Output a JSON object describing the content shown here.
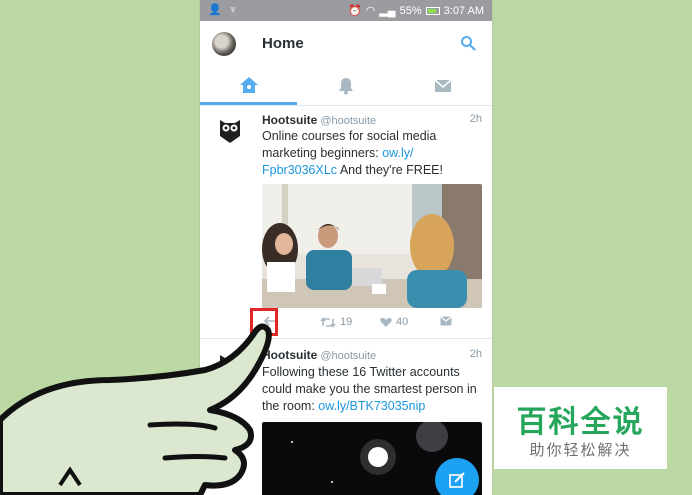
{
  "status_bar": {
    "battery": "55%",
    "time": "3:07 AM"
  },
  "header": {
    "title": "Home"
  },
  "tabs": [
    {
      "name": "home",
      "icon": "home-icon",
      "active": true
    },
    {
      "name": "notifications",
      "icon": "bell-icon",
      "active": false
    },
    {
      "name": "messages",
      "icon": "envelope-icon",
      "active": false
    }
  ],
  "tweets": [
    {
      "name": "Hootsuite",
      "handle": "@hootsuite",
      "time": "2h",
      "text_before": "Online courses for social media marketing beginners: ",
      "link": "ow.ly/ Fpbr3036XLc",
      "text_after": " And they're FREE!",
      "retweets": "19",
      "likes": "40"
    },
    {
      "name": "Hootsuite",
      "handle": "@hootsuite",
      "time": "2h",
      "text_before": "Following these 16 Twitter accounts could make you the smartest person in the room: ",
      "link": "ow.ly/BTK73035nip",
      "text_after": ""
    }
  ],
  "watermark": {
    "title": "百科全说",
    "subtitle": "助你轻松解决"
  },
  "colors": {
    "background": "#bcd9a4",
    "twitter_blue": "#55acee",
    "highlight_red": "#e3262a",
    "watermark_green": "#26a65b"
  }
}
